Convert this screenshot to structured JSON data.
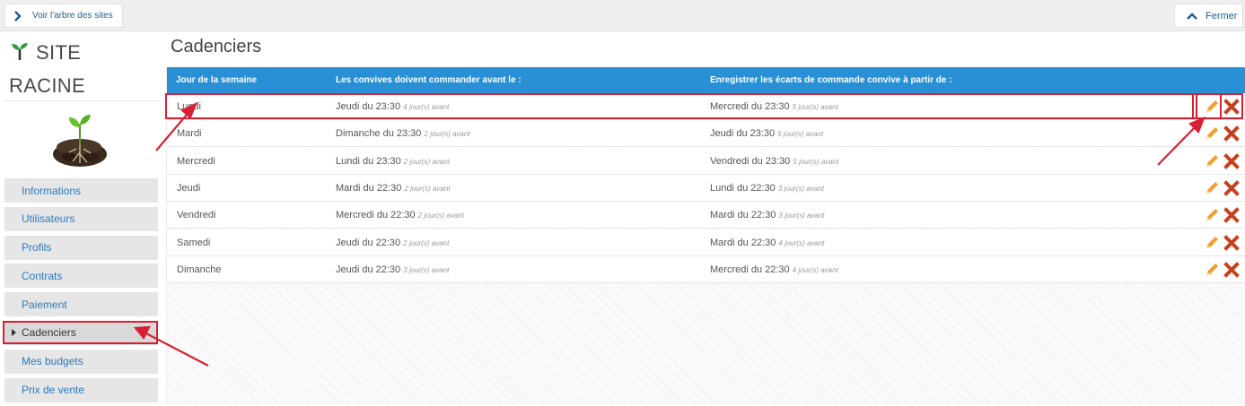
{
  "topbar": {
    "tree_label": "Voir l'arbre des sites",
    "close_label": "Fermer"
  },
  "sidebar": {
    "site_name_line1": "SITE",
    "site_name_line2": "RACINE",
    "items": [
      {
        "label": "Informations"
      },
      {
        "label": "Utilisateurs"
      },
      {
        "label": "Profils"
      },
      {
        "label": "Contrats"
      },
      {
        "label": "Paiement"
      },
      {
        "label": "Cadenciers"
      },
      {
        "label": "Mes budgets"
      },
      {
        "label": "Prix de vente"
      }
    ],
    "active_item": "Cadenciers"
  },
  "main": {
    "title": "Cadenciers",
    "columns": [
      "Jour de la semaine",
      "Les convives doivent commander avant le :",
      "Enregistrer les écarts de commande convive à partir de :"
    ],
    "rows": [
      {
        "day": "Lundi",
        "order_before": "Jeudi du 23:30",
        "order_note": "4 jour(s) avant",
        "record_from": "Mercredi du 23:30",
        "record_note": "5 jour(s) avant"
      },
      {
        "day": "Mardi",
        "order_before": "Dimanche du 23:30",
        "order_note": "2 jour(s) avant",
        "record_from": "Jeudi du 23:30",
        "record_note": "5 jour(s) avant"
      },
      {
        "day": "Mercredi",
        "order_before": "Lundi du 23:30",
        "order_note": "2 jour(s) avant",
        "record_from": "Vendredi du 23:30",
        "record_note": "5 jour(s) avant"
      },
      {
        "day": "Jeudi",
        "order_before": "Mardi du 22:30",
        "order_note": "2 jour(s) avant",
        "record_from": "Lundi du 22:30",
        "record_note": "3 jour(s) avant"
      },
      {
        "day": "Vendredi",
        "order_before": "Mercredi du 22:30",
        "order_note": "2 jour(s) avant",
        "record_from": "Mardi du 22:30",
        "record_note": "3 jour(s) avant"
      },
      {
        "day": "Samedi",
        "order_before": "Jeudi du 22:30",
        "order_note": "2 jour(s) avant",
        "record_from": "Mardi du 22:30",
        "record_note": "4 jour(s) avant"
      },
      {
        "day": "Dimanche",
        "order_before": "Jeudi du 22:30",
        "order_note": "3 jour(s) avant",
        "record_from": "Mercredi du 22:30",
        "record_note": "4 jour(s) avant"
      }
    ]
  },
  "icons": {
    "tree_chevron": "chevron-right-icon",
    "close_chevron": "chevron-up-icon",
    "row_edit": "pencil-icon",
    "row_delete": "delete-x-icon"
  },
  "colors": {
    "header_blue": "#2990d6",
    "link_blue": "#2a7bbf",
    "annotation_red": "#d62132",
    "edit_orange": "#f0a030",
    "delete_red": "#c7401f"
  }
}
